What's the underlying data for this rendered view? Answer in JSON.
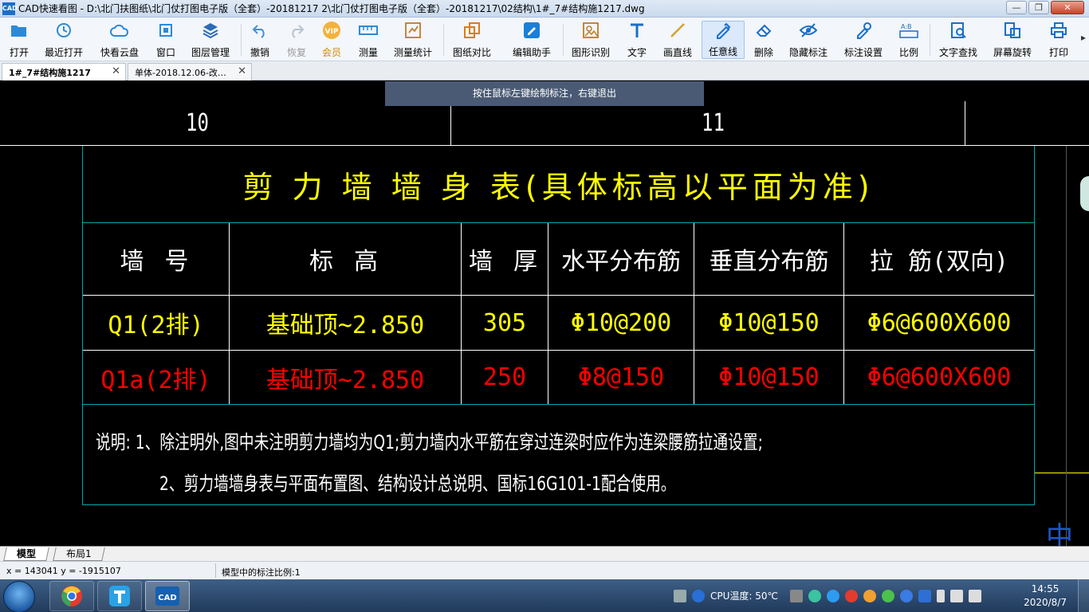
{
  "window": {
    "title": "CAD快速看图 - D:\\北门扶图纸\\北门仗打图电子版（全套）-20181217 2\\北门仗打图电子版（全套）-20181217\\02结构\\1#_7#结构施1217.dwg",
    "logo_text": "CAD",
    "minimize": "—",
    "maximize": "❐",
    "close": "✕"
  },
  "toolbar": {
    "items": [
      {
        "label": "打开",
        "icon": "folder-icon"
      },
      {
        "label": "最近打开",
        "icon": "recent-icon"
      },
      {
        "label": "快看云盘",
        "icon": "cloud-icon"
      },
      {
        "label": "窗口",
        "icon": "window-icon"
      },
      {
        "label": "图层管理",
        "icon": "layers-icon"
      },
      {
        "label": "撤销",
        "icon": "undo-icon"
      },
      {
        "label": "恢复",
        "icon": "redo-icon"
      },
      {
        "label": "会员",
        "icon": "vip-icon"
      },
      {
        "label": "测量",
        "icon": "ruler-icon"
      },
      {
        "label": "测量统计",
        "icon": "measure-stats-icon"
      },
      {
        "label": "图纸对比",
        "icon": "compare-icon"
      },
      {
        "label": "编辑助手",
        "icon": "edit-helper-icon"
      },
      {
        "label": "图形识别",
        "icon": "shape-recognition-icon"
      },
      {
        "label": "文字",
        "icon": "text-icon"
      },
      {
        "label": "画直线",
        "icon": "line-icon"
      },
      {
        "label": "任意线",
        "icon": "freehand-icon"
      },
      {
        "label": "删除",
        "icon": "eraser-icon"
      },
      {
        "label": "隐藏标注",
        "icon": "hide-icon"
      },
      {
        "label": "标注设置",
        "icon": "annotation-settings-icon"
      },
      {
        "label": "比例",
        "icon": "scale-icon"
      },
      {
        "label": "文字查找",
        "icon": "text-search-icon"
      },
      {
        "label": "屏幕旋转",
        "icon": "rotate-icon"
      },
      {
        "label": "打印",
        "icon": "print-icon"
      }
    ],
    "more": "▸",
    "vip_text": "VIP"
  },
  "tabs": [
    {
      "label": "1#_7#结构施1217",
      "close": "✕"
    },
    {
      "label": "单体-2018.12.06-改…",
      "close": "✕"
    }
  ],
  "hint": "按住鼠标左键绘制标注，右键退出",
  "drawing": {
    "axis_labels": [
      "10",
      "11"
    ],
    "table_title": "剪 力 墙 墙 身 表(具体标高以平面为准)",
    "headers": [
      "墙 号",
      "标   高",
      "墙 厚",
      "水平分布筋",
      "垂直分布筋",
      "拉   筋(双向)"
    ],
    "rows": [
      {
        "cells": [
          "Q1(2排)",
          "基础顶~2.850",
          "305",
          "Φ10@200",
          "Φ10@150",
          "Φ6@600X600"
        ],
        "color": "#ffff00"
      },
      {
        "cells": [
          "Q1a(2排)",
          "基础顶~2.850",
          "250",
          "Φ8@150",
          "Φ10@150",
          "Φ6@600X600"
        ],
        "color": "#ff0000"
      }
    ],
    "notes": [
      "说明:  1、除注明外,图中未注明剪力墙均为Q1;剪力墙内水平筋在穿过连梁时应作为连梁腰筋拉通设置;",
      "2、剪力墙墙身表与平面布置图、结构设计总说明、国标16G101-1配合使用。"
    ],
    "edge_text": "中国"
  },
  "layout_tabs": [
    "模型",
    "布局1"
  ],
  "status": {
    "coords": "x = 143041  y = -1915107",
    "scale": "模型中的标注比例:1"
  },
  "taskbar": {
    "apps": [
      "chrome-icon",
      "t-app-icon",
      "cad-app-icon"
    ],
    "cpu_temp": "CPU温度: 50℃",
    "time": "14:55",
    "date": "2020/8/7"
  }
}
